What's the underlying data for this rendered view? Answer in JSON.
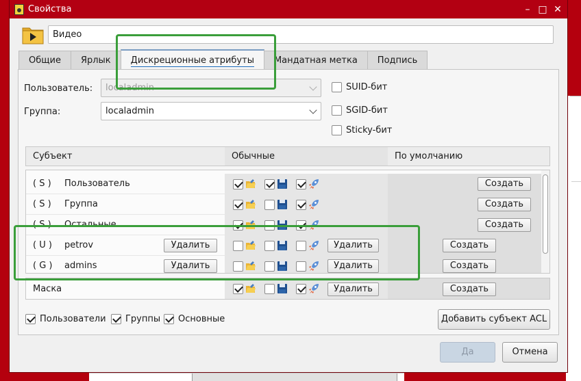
{
  "window": {
    "title": "Свойства",
    "controls": [
      "–",
      "□",
      "✕"
    ]
  },
  "header": {
    "name_value": "Видео"
  },
  "tabs": [
    {
      "label": "Общие",
      "active": false
    },
    {
      "label": "Ярлык",
      "active": false
    },
    {
      "label": "Дискреционные атрибуты",
      "active": true
    },
    {
      "label": "Мандатная метка",
      "active": false
    },
    {
      "label": "Подпись",
      "active": false
    }
  ],
  "owner": {
    "user_label": "Пользователь:",
    "user_value": "localadmin",
    "group_label": "Группа:",
    "group_value": "localadmin"
  },
  "special_bits": [
    {
      "label": "SUID-бит",
      "checked": false
    },
    {
      "label": "SGID-бит",
      "checked": false
    },
    {
      "label": "Sticky-бит",
      "checked": false
    }
  ],
  "table": {
    "headers": {
      "subject": "Субъект",
      "normal": "Обычные",
      "default": "По умолчанию"
    },
    "rows": [
      {
        "tag": "( S )",
        "name": "Пользователь",
        "perms": [
          true,
          true,
          true
        ],
        "delete": "",
        "perm_delete": "",
        "create": "Создать"
      },
      {
        "tag": "( S )",
        "name": "Группа",
        "perms": [
          true,
          false,
          true
        ],
        "delete": "",
        "perm_delete": "",
        "create": "Создать"
      },
      {
        "tag": "( S )",
        "name": "Остальные",
        "perms": [
          true,
          false,
          true
        ],
        "delete": "",
        "perm_delete": "",
        "create": "Создать"
      },
      {
        "tag": "( U )",
        "name": "petrov",
        "perms": [
          false,
          false,
          false
        ],
        "delete": "Удалить",
        "perm_delete": "Удалить",
        "create": "Создать"
      },
      {
        "tag": "( G )",
        "name": "admins",
        "perms": [
          false,
          false,
          false
        ],
        "delete": "Удалить",
        "perm_delete": "Удалить",
        "create": "Создать"
      }
    ],
    "mask": {
      "name": "Маска",
      "perms": [
        true,
        false,
        true
      ],
      "perm_delete": "Удалить",
      "create": "Создать"
    }
  },
  "filters": [
    {
      "label": "Пользователи",
      "checked": true
    },
    {
      "label": "Группы",
      "checked": true
    },
    {
      "label": "Основные",
      "checked": true
    }
  ],
  "add_subject_button": "Добавить субъект ACL",
  "footer": {
    "ok": "Да",
    "cancel": "Отмена"
  },
  "colors": {
    "titlebar": "#b30012",
    "highlight": "#3a9e3a",
    "accent": "#1a6bbd"
  }
}
